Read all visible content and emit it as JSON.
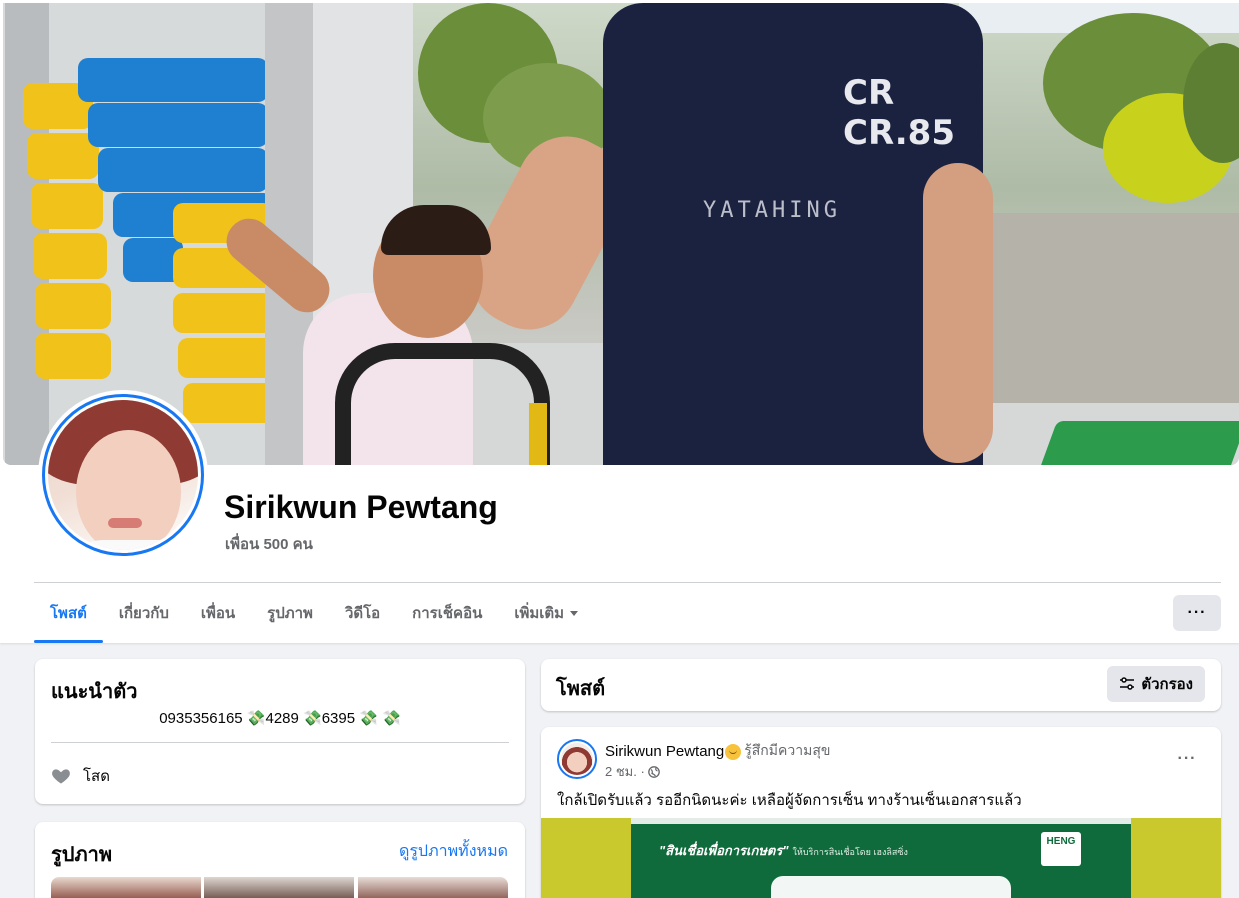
{
  "profile": {
    "name": "Sirikwun Pewtang",
    "friends": "เพื่อน 500 คน"
  },
  "tabs": [
    {
      "label": "โพสต์",
      "active": true
    },
    {
      "label": "เกี่ยวกับ"
    },
    {
      "label": "เพื่อน"
    },
    {
      "label": "รูปภาพ"
    },
    {
      "label": "วิดีโอ"
    },
    {
      "label": "การเช็คอิน"
    },
    {
      "label": "เพิ่มเติม"
    }
  ],
  "more_button": "···",
  "intro": {
    "title": "แนะนำตัว",
    "bio": "0935356165 💸4289 💸6395 💸 💸",
    "relationship": "โสด",
    "relationship_icon": "heart-icon"
  },
  "photos": {
    "title": "รูปภาพ",
    "see_all": "ดูรูปภาพทั้งหมด"
  },
  "posts_header": {
    "title": "โพสต์",
    "filter_label": "ตัวกรอง",
    "filter_icon": "sliders-icon"
  },
  "post": {
    "author": "Sirikwun Pewtang",
    "feeling": "รู้สึกมีความสุข",
    "time": "2 ชม. ·",
    "privacy_icon": "globe-icon",
    "options": "···",
    "text": "ใกล้เปิดรับแล้ว รออีกนิดนะค่ะ เหลือผู้จัดการเซ็น ทางร้านเซ็นเอกสารแล้ว",
    "image_banner": "\"สินเชื่อเพื่อการเกษตร\"",
    "image_banner_sub": "ให้บริการสินเชื่อโดย เฮงลิสซิ่ง",
    "image_logo": "HENG"
  },
  "colors": {
    "accent": "#1877f2",
    "secondary_text": "#65676b",
    "background": "#f0f2f5"
  }
}
